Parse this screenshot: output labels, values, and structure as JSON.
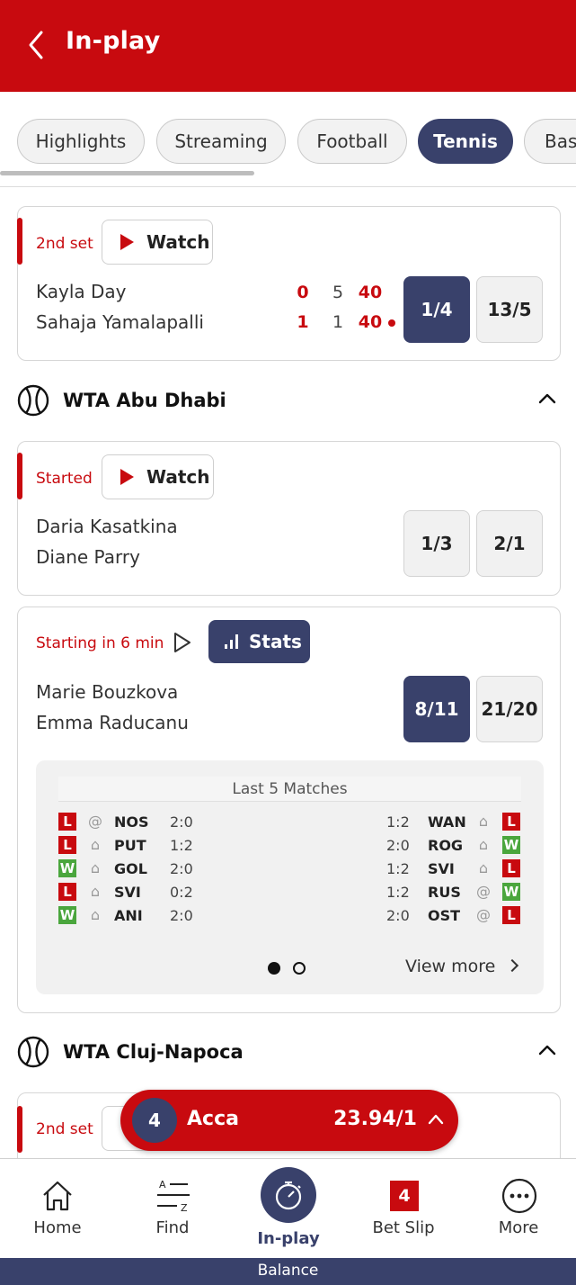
{
  "header": {
    "title": "In-play"
  },
  "tabs": [
    "Highlights",
    "Streaming",
    "Football",
    "Tennis",
    "Bas"
  ],
  "events": [
    {
      "status": "2nd set",
      "watch_label": "Watch",
      "players": [
        "Kayla Day",
        "Sahaja Yamalapalli"
      ],
      "scores": [
        [
          "0",
          "5",
          "40"
        ],
        [
          "1",
          "1",
          "40"
        ]
      ],
      "odds": [
        "1/4",
        "13/5"
      ]
    }
  ],
  "sections": [
    {
      "name": "WTA Abu Dhabi",
      "events": [
        {
          "status": "Started",
          "watch_label": "Watch",
          "players": [
            "Daria Kasatkina",
            "Diane Parry"
          ],
          "odds": [
            "1/3",
            "2/1"
          ]
        },
        {
          "status": "Starting in 6 min",
          "stats_label": "Stats",
          "players": [
            "Marie Bouzkova",
            "Emma Raducanu"
          ],
          "odds": [
            "8/11",
            "21/20"
          ],
          "last5": {
            "heading": "Last 5 Matches",
            "home": [
              {
                "result": "L",
                "venue": "@",
                "opponent": "NOS",
                "score": "2:0"
              },
              {
                "result": "L",
                "venue": "home",
                "opponent": "PUT",
                "score": "1:2"
              },
              {
                "result": "W",
                "venue": "home",
                "opponent": "GOL",
                "score": "2:0"
              },
              {
                "result": "L",
                "venue": "home",
                "opponent": "SVI",
                "score": "0:2"
              },
              {
                "result": "W",
                "venue": "home",
                "opponent": "ANI",
                "score": "2:0"
              }
            ],
            "away": [
              {
                "result": "L",
                "venue": "home",
                "opponent": "WAN",
                "score": "1:2"
              },
              {
                "result": "W",
                "venue": "home",
                "opponent": "ROG",
                "score": "2:0"
              },
              {
                "result": "L",
                "venue": "home",
                "opponent": "SVI",
                "score": "1:2"
              },
              {
                "result": "W",
                "venue": "@",
                "opponent": "RUS",
                "score": "1:2"
              },
              {
                "result": "L",
                "venue": "@",
                "opponent": "OST",
                "score": "2:0"
              }
            ],
            "view_more": "View more"
          }
        }
      ]
    },
    {
      "name": "WTA Cluj-Napoca",
      "events": [
        {
          "status": "2nd set"
        }
      ]
    }
  ],
  "acca": {
    "count": "4",
    "label": "Acca",
    "price": "23.94/1"
  },
  "bottom_nav": {
    "items": [
      "Home",
      "Find",
      "In-play",
      "Bet Slip",
      "More"
    ],
    "betslip_count": "4",
    "balance": "Balance"
  },
  "colors": {
    "brand_red": "#c80a0f",
    "navy": "#39416b",
    "win_green": "#4aa63d"
  }
}
